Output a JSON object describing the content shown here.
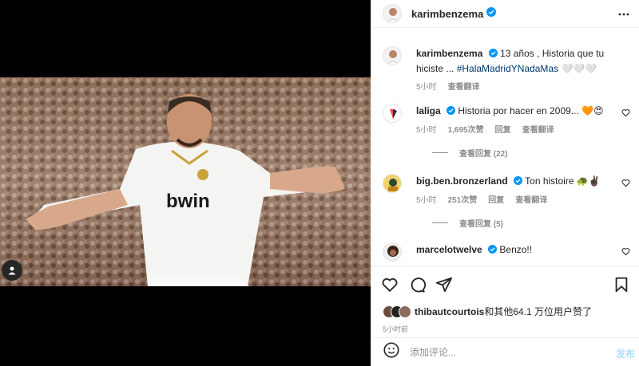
{
  "post": {
    "author": "karimbenzema",
    "author_verified": true,
    "caption_text": "13 años , Historia que tu hiciste ...",
    "caption_hashtag": "#HalaMadridYNadaMas",
    "caption_emoji": "🤍🤍🤍",
    "caption_time": "5小时",
    "caption_translate": "查看翻译",
    "photo_jersey_text": "bwin"
  },
  "comments": [
    {
      "user": "laliga",
      "verified": true,
      "text": "Historia por hacer en 2009... 🧡😍",
      "time": "5小时",
      "likes": "1,695次赞",
      "reply": "回复",
      "translate": "查看翻译",
      "view_replies": "查看回复 (22)"
    },
    {
      "user": "big.ben.bronzerland",
      "verified": true,
      "text": "Ton histoire 🐢✌🏿",
      "time": "5小时",
      "likes": "251次赞",
      "reply": "回复",
      "translate": "查看翻译",
      "view_replies": "查看回复 (5)"
    },
    {
      "user": "marcelotwelve",
      "verified": true,
      "text": "Benzo!!"
    }
  ],
  "likes_summary": {
    "liker": "thibautcourtois",
    "rest": "和其他64.1 万位用户赞了"
  },
  "time_ago": "5小时前",
  "add_comment": {
    "emoji_icon": "smiley-icon",
    "placeholder": "添加评论...",
    "post_label": "发布"
  },
  "colors": {
    "accent_blue": "#0095f6",
    "hashtag": "#00376b",
    "muted": "#8e8e8e",
    "post_disabled": "#b2dffc"
  }
}
